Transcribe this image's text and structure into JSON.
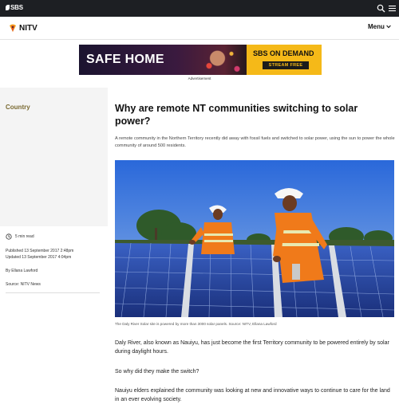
{
  "header": {
    "brand": "SBS",
    "search_icon": "search-icon",
    "menu_icon": "hamburger-icon"
  },
  "nav": {
    "logo_text": "NITV",
    "menu_label": "Menu"
  },
  "ad": {
    "headline": "SAFE HOME",
    "brand": "SBS ON DEMAND",
    "cta": "STREAM FREE",
    "label": "Advertisement"
  },
  "sidebar": {
    "category": "Country",
    "read_time": "5 min read",
    "published": "Published 13 September 2017 2:48pm",
    "updated": "Updated 13 September 2017 4:04pm",
    "byline": "By Ellana Lawford",
    "source": "Source: NITV News"
  },
  "article": {
    "title": "Why are remote NT communities switching to solar power?",
    "summary": "A remote community in the Northern Territory recently did away with fossil fuels and switched to solar power, using the sun to power the whole community of around 500 residents.",
    "caption": "The Daly River Solar site is powered by more than 3000 solar panels. Source: NITV, Ellana Lawford",
    "paragraphs": [
      "Daly River, also known as Nauiyu, has just become the first Territory community to be powered entirely by solar during daylight hours.",
      "So why did they make the switch?",
      "Nauiyu elders explained the community was looking at new and innovative ways to continue to care for the land in an ever evolving society."
    ]
  },
  "colors": {
    "topbar": "#1d1f23",
    "category": "#7a6a32",
    "ad_yellow": "#f5b918"
  }
}
